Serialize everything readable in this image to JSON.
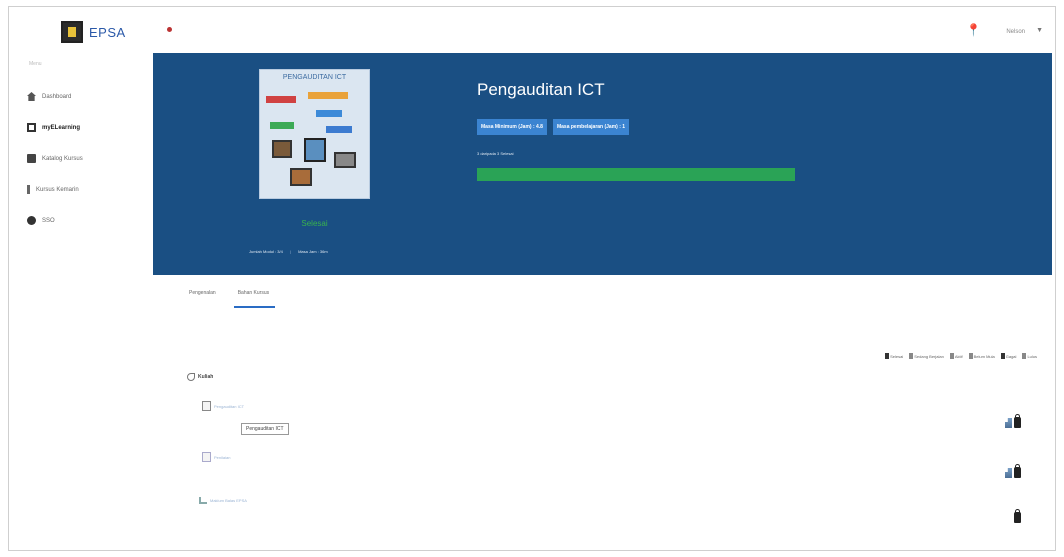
{
  "brand": {
    "name": "EPSA"
  },
  "sidebar": {
    "heading": "Menu",
    "items": [
      {
        "label": "Dashboard",
        "icon": "home-icon"
      },
      {
        "label": "myELearning",
        "icon": "book-icon",
        "active": true
      },
      {
        "label": "Katalog Kursus",
        "icon": "catalog-icon"
      },
      {
        "label": "Kursus Kemarin",
        "icon": "recent-icon"
      },
      {
        "label": "SSO",
        "icon": "gear-icon"
      }
    ]
  },
  "header": {
    "user_name": "Nelson"
  },
  "course": {
    "title": "Pengauditan ICT",
    "cover_title": "PENGAUDITAN ICT",
    "status": "Selesai",
    "meta_left": "Jumlah Modul : 3/4",
    "meta_right": "Masa Jam : 36m",
    "badges": [
      "Masa Minimum (Jam) : 4.8",
      "Masa pembelajaran (Jam) : 1"
    ],
    "progress_label": "3 daripada 3 Selesai",
    "progress": 1.0,
    "progress_color": "#2aa356"
  },
  "tabs": [
    {
      "label": "Pengenalan",
      "active": false
    },
    {
      "label": "Bahan Kursus",
      "active": true
    }
  ],
  "actions": [
    {
      "label": "Selesai",
      "icon": "lock-icon"
    },
    {
      "label": "Sedang Berjalan",
      "icon": "half-lock-icon"
    },
    {
      "label": "Aktif",
      "icon": "unlock-icon"
    },
    {
      "label": "Belum Mula",
      "icon": "lock-open-icon"
    },
    {
      "label": "Gagal",
      "icon": "fail-icon"
    },
    {
      "label": "Lulus",
      "icon": "pass-icon"
    }
  ],
  "tree": {
    "root": "Kuliah",
    "nodes": [
      {
        "label": "Pengauditan ICT",
        "tooltip": "Pengauditan ICT"
      },
      {
        "label": "Penilaian"
      },
      {
        "label": "Maklum Balas EPSA"
      }
    ]
  }
}
